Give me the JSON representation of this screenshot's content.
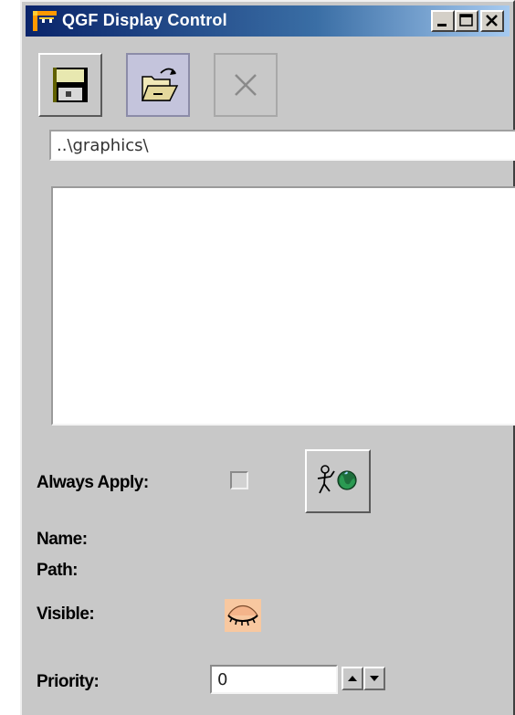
{
  "window": {
    "title": "QGF Display Control"
  },
  "titlebar_buttons": [
    "minimize",
    "maximize",
    "close"
  ],
  "toolbar": {
    "buttons": [
      {
        "name": "save",
        "icon": "floppy-disk-icon",
        "state": "normal"
      },
      {
        "name": "open",
        "icon": "open-folder-icon",
        "state": "pressed"
      },
      {
        "name": "delete",
        "icon": "x-icon",
        "state": "disabled"
      }
    ]
  },
  "path": {
    "value": "..\\graphics\\"
  },
  "file_list": {
    "items": []
  },
  "properties": {
    "always_apply_label": "Always Apply:",
    "always_apply_checked": false,
    "apply_button_icon": "run-to-globe-icon",
    "name_label": "Name:",
    "path_label": "Path:",
    "visible_label": "Visible:",
    "visible_icon": "closed-eye-icon",
    "priority_label": "Priority:",
    "priority_value": "0"
  },
  "colors": {
    "titlebar_start": "#0a246a",
    "titlebar_end": "#a6caf0",
    "window_bg": "#c8c8c8",
    "eye_bg": "#f8c8a0"
  }
}
